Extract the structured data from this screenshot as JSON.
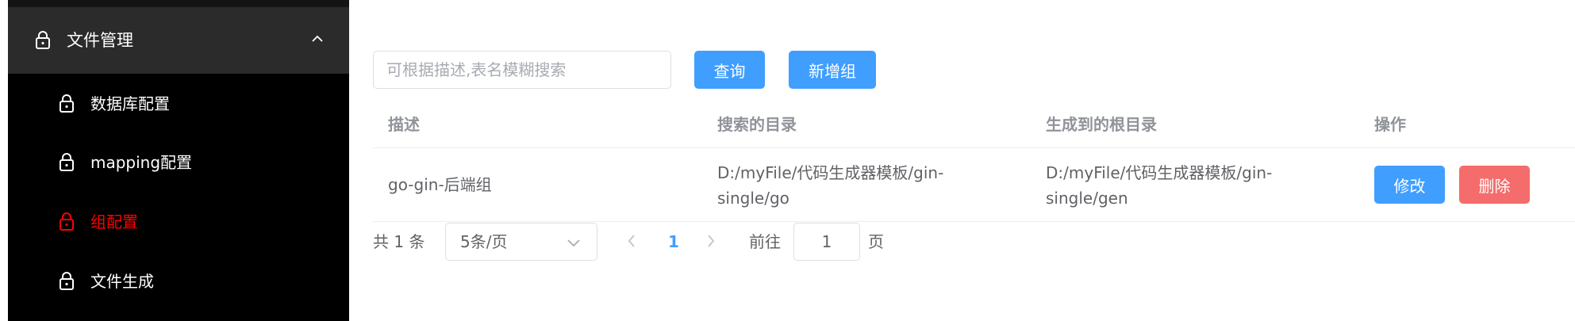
{
  "sidebar": {
    "parent": {
      "label": "文件管理"
    },
    "items": [
      {
        "label": "数据库配置",
        "active": false
      },
      {
        "label": "mapping配置",
        "active": false
      },
      {
        "label": "组配置",
        "active": true
      },
      {
        "label": "文件生成",
        "active": false
      }
    ]
  },
  "search": {
    "placeholder": "可根据描述,表名模糊搜索",
    "value": ""
  },
  "toolbar": {
    "query_label": "查询",
    "add_label": "新增组"
  },
  "table": {
    "headers": [
      "描述",
      "搜索的目录",
      "生成到的根目录",
      "操作"
    ],
    "rows": [
      {
        "desc": "go-gin-后端组",
        "search_dir_l1": "D:/myFile/代码生成器模板/gin-",
        "search_dir_l2": "single/go",
        "gen_dir_l1": "D:/myFile/代码生成器模板/gin-",
        "gen_dir_l2": "single/gen",
        "edit_label": "修改",
        "delete_label": "删除"
      }
    ]
  },
  "pagination": {
    "total_text": "共 1 条",
    "page_size": "5条/页",
    "current_page": "1",
    "goto_label": "前往",
    "goto_value": "1",
    "page_suffix": "页"
  },
  "colors": {
    "primary": "#409eff",
    "danger": "#f56c6c",
    "active_menu": "#ff0000",
    "sidebar_bg": "#000000"
  }
}
